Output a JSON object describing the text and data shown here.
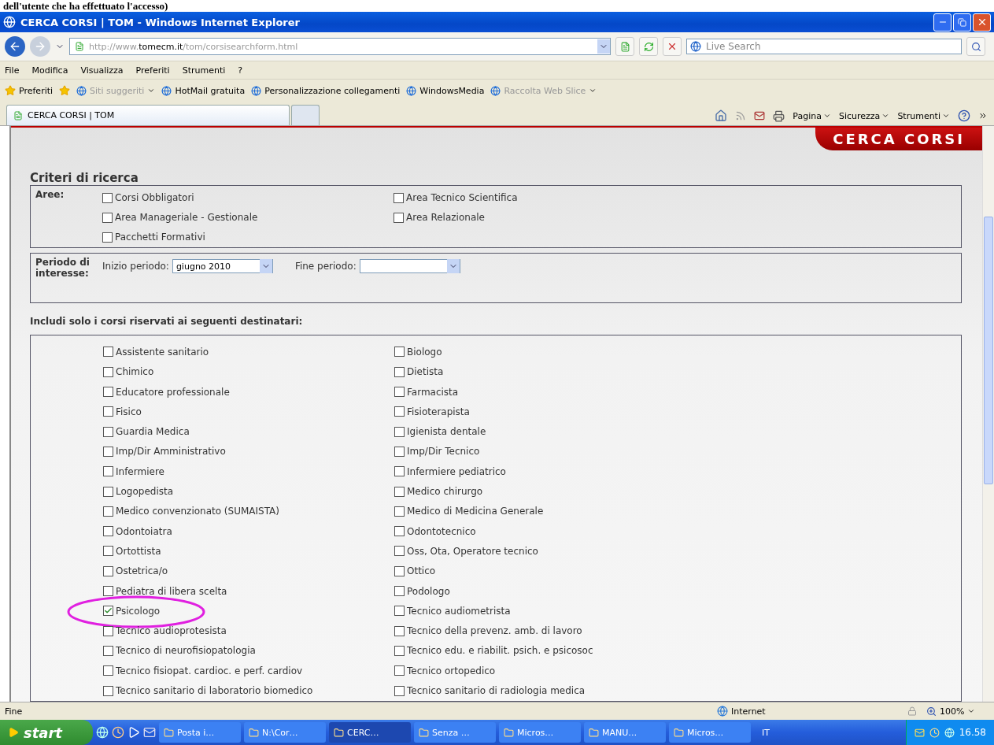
{
  "caption": "dell'utente che ha effettuato l'accesso)",
  "window": {
    "title": "CERCA CORSI | TOM - Windows Internet Explorer"
  },
  "address": {
    "url": "http://www.**tomecm.it**/tom/corsisearchform.html"
  },
  "search": {
    "placeholder": "Live Search"
  },
  "menu": [
    "File",
    "Modifica",
    "Visualizza",
    "Preferiti",
    "Strumenti",
    "?"
  ],
  "favorites_bar": {
    "favorites": "Preferiti",
    "links": [
      {
        "label": "Siti suggeriti",
        "dimmed": true,
        "dropdown": true
      },
      {
        "label": "HotMail gratuita",
        "dimmed": false,
        "dropdown": false
      },
      {
        "label": "Personalizzazione collegamenti",
        "dimmed": false,
        "dropdown": false
      },
      {
        "label": "WindowsMedia",
        "dimmed": false,
        "dropdown": false
      },
      {
        "label": "Raccolta Web Slice",
        "dimmed": true,
        "dropdown": true
      }
    ]
  },
  "tabs": [
    {
      "label": "CERCA CORSI | TOM",
      "selected": true
    },
    {
      "selected": false
    }
  ],
  "command_bar": [
    "Pagina",
    "Sicurezza",
    "Strumenti"
  ],
  "page": {
    "banner": "CERCA CORSI",
    "heading": "Criteri di ricerca",
    "areas": {
      "label": "Aree:",
      "options": [
        {
          "label": "Corsi Obbligatori",
          "checked": false
        },
        {
          "label": "Area Tecnico Scientifica",
          "checked": false
        },
        {
          "label": "Area Manageriale - Gestionale",
          "checked": false
        },
        {
          "label": "Area Relazionale",
          "checked": false
        },
        {
          "label": "Pacchetti Formativi",
          "checked": false
        }
      ]
    },
    "period": {
      "label": "Periodo di interesse:",
      "start_label": "Inizio periodo:",
      "start_value": "giugno 2010",
      "end_label": "Fine periodo:"
    },
    "recipients_label": "Includi solo i corsi riservati ai seguenti destinatari:",
    "recipients": [
      {
        "label": "Assistente sanitario",
        "checked": false,
        "circled": false
      },
      {
        "label": "Biologo",
        "checked": false,
        "circled": false
      },
      {
        "label": "Chimico",
        "checked": false,
        "circled": false
      },
      {
        "label": "Dietista",
        "checked": false,
        "circled": false
      },
      {
        "label": "Educatore professionale",
        "checked": false,
        "circled": false
      },
      {
        "label": "Farmacista",
        "checked": false,
        "circled": false
      },
      {
        "label": "Fisico",
        "checked": false,
        "circled": false
      },
      {
        "label": "Fisioterapista",
        "checked": false,
        "circled": false
      },
      {
        "label": "Guardia Medica",
        "checked": false,
        "circled": false
      },
      {
        "label": "Igienista dentale",
        "checked": false,
        "circled": false
      },
      {
        "label": "Imp/Dir Amministrativo",
        "checked": false,
        "circled": false
      },
      {
        "label": "Imp/Dir Tecnico",
        "checked": false,
        "circled": false
      },
      {
        "label": "Infermiere",
        "checked": false,
        "circled": false
      },
      {
        "label": "Infermiere pediatrico",
        "checked": false,
        "circled": false
      },
      {
        "label": "Logopedista",
        "checked": false,
        "circled": false
      },
      {
        "label": "Medico chirurgo",
        "checked": false,
        "circled": false
      },
      {
        "label": "Medico convenzionato (SUMAISTA)",
        "checked": false,
        "circled": false
      },
      {
        "label": "Medico di Medicina Generale",
        "checked": false,
        "circled": false
      },
      {
        "label": "Odontoiatra",
        "checked": false,
        "circled": false
      },
      {
        "label": "Odontotecnico",
        "checked": false,
        "circled": false
      },
      {
        "label": "Ortottista",
        "checked": false,
        "circled": false
      },
      {
        "label": "Oss, Ota, Operatore tecnico",
        "checked": false,
        "circled": false
      },
      {
        "label": "Ostetrica/o",
        "checked": false,
        "circled": false
      },
      {
        "label": "Ottico",
        "checked": false,
        "circled": false
      },
      {
        "label": "Pediatra di libera scelta",
        "checked": false,
        "circled": false
      },
      {
        "label": "Podologo",
        "checked": false,
        "circled": false
      },
      {
        "label": "Psicologo",
        "checked": true,
        "circled": true
      },
      {
        "label": "Tecnico audiometrista",
        "checked": false,
        "circled": false
      },
      {
        "label": "Tecnico audioprotesista",
        "checked": false,
        "circled": false
      },
      {
        "label": "Tecnico della prevenz. amb. di lavoro",
        "checked": false,
        "circled": false
      },
      {
        "label": "Tecnico di neurofisiopatologia",
        "checked": false,
        "circled": false
      },
      {
        "label": "Tecnico edu. e riabilit. psich. e psicosoc",
        "checked": false,
        "circled": false
      },
      {
        "label": "Tecnico fisiopat. cardioc. e perf. cardiov",
        "checked": false,
        "circled": false
      },
      {
        "label": "Tecnico ortopedico",
        "checked": false,
        "circled": false
      },
      {
        "label": "Tecnico sanitario di laboratorio biomedico",
        "checked": false,
        "circled": false
      },
      {
        "label": "Tecnico sanitario di radiologia medica",
        "checked": false,
        "circled": false
      }
    ]
  },
  "status_bar": {
    "text": "Fine",
    "zone": "Internet",
    "zoom": "100%"
  },
  "taskbar": {
    "start": "start",
    "tasks": [
      {
        "label": "Posta i…",
        "selected": false
      },
      {
        "label": "N:\\Cor…",
        "selected": false
      },
      {
        "label": "CERC…",
        "selected": true
      },
      {
        "label": "Senza …",
        "selected": false
      },
      {
        "label": "Micros…",
        "selected": false
      },
      {
        "label": "MANU…",
        "selected": false
      },
      {
        "label": "Micros…",
        "selected": false
      }
    ],
    "language": "IT",
    "clock": "16.58"
  }
}
